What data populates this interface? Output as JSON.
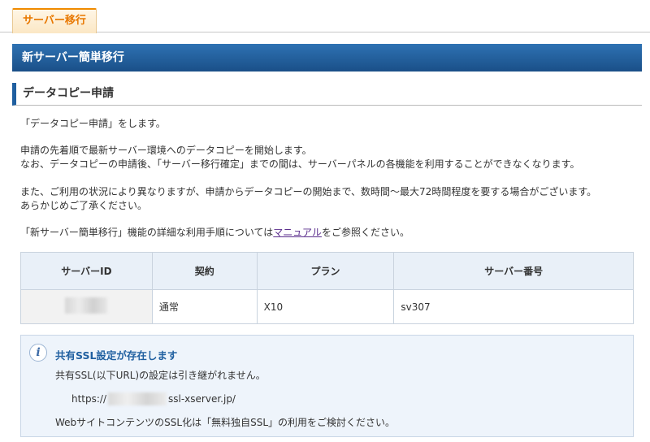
{
  "tabs": [
    {
      "label": "サーバー移行"
    }
  ],
  "header": {
    "title": "新サーバー簡単移行"
  },
  "section": {
    "title": "データコピー申請"
  },
  "paragraphs": {
    "p1": "「データコピー申請」をします。",
    "p2a": "申請の先着順で最新サーバー環境へのデータコピーを開始します。",
    "p2b": "なお、データコピーの申請後、「サーバー移行確定」までの間は、サーバーパネルの各機能を利用することができなくなります。",
    "p3a": "また、ご利用の状況により異なりますが、申請からデータコピーの開始まで、数時間～最大72時間程度を要する場合がございます。",
    "p3b": "あらかじめご了承ください。",
    "p4_before": "「新サーバー簡単移行」機能の詳細な利用手順については",
    "p4_link": "マニュアル",
    "p4_after": "をご参照ください。"
  },
  "table": {
    "headers": [
      "サーバーID",
      "契約",
      "プラン",
      "サーバー番号"
    ],
    "row": {
      "server_id": "",
      "contract": "通常",
      "plan": "X10",
      "server_number": "sv307"
    }
  },
  "notice": {
    "title": "共有SSL設定が存在します",
    "line1": "共有SSL(以下URL)の設定は引き継がれません。",
    "url_prefix": "https://",
    "url_suffix": "ssl-xserver.jp/",
    "line3": "WebサイトコンテンツのSSL化は「無料独自SSL」の利用をご検討ください。"
  },
  "colors": {
    "accent": "#1f5fa0",
    "tab": "#e87800",
    "header": "#2e72b3"
  },
  "icons": {
    "notice": "info-icon"
  }
}
